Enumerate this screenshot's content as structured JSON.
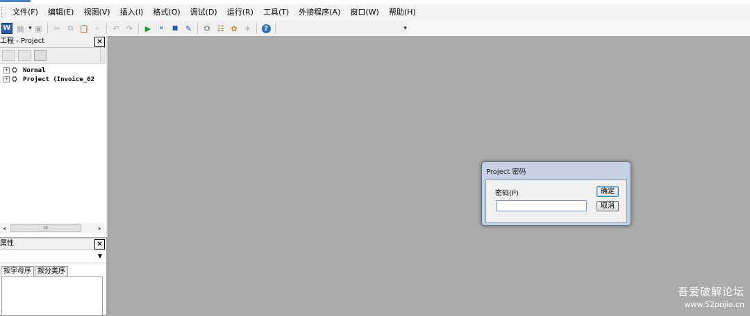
{
  "menubar": {
    "items": [
      "文件(F)",
      "编辑(E)",
      "视图(V)",
      "插入(I)",
      "格式(O)",
      "调试(D)",
      "运行(R)",
      "工具(T)",
      "外接程序(A)",
      "窗口(W)",
      "帮助(H)"
    ]
  },
  "toolbar": {
    "buttons": [
      {
        "icon": "word-icon",
        "glyph": "W"
      },
      {
        "icon": "insert-userform-icon",
        "glyph": "▦"
      },
      {
        "icon": "save-icon",
        "glyph": "▣"
      },
      {
        "icon": "cut-icon",
        "glyph": "✂"
      },
      {
        "icon": "copy-icon",
        "glyph": "⧉"
      },
      {
        "icon": "paste-icon",
        "glyph": "📋"
      },
      {
        "icon": "find-icon",
        "glyph": "⌕"
      },
      {
        "icon": "undo-icon",
        "glyph": "↶"
      },
      {
        "icon": "redo-icon",
        "glyph": "↷"
      },
      {
        "icon": "run-icon",
        "glyph": "▶"
      },
      {
        "icon": "break-icon",
        "glyph": "⏸"
      },
      {
        "icon": "reset-icon",
        "glyph": "■"
      },
      {
        "icon": "design-mode-icon",
        "glyph": "✎"
      },
      {
        "icon": "project-explorer-icon",
        "glyph": "⛭"
      },
      {
        "icon": "properties-window-icon",
        "glyph": "☷"
      },
      {
        "icon": "object-browser-icon",
        "glyph": "✿"
      },
      {
        "icon": "toolbox-icon",
        "glyph": "✈"
      },
      {
        "icon": "help-icon",
        "glyph": "?"
      }
    ]
  },
  "project_panel": {
    "title": "工程 - Project",
    "close": "×",
    "tree": [
      {
        "expander": "+",
        "label": "Normal"
      },
      {
        "expander": "+",
        "label": "Project (Invoice_62"
      }
    ],
    "hscroll_thumb": "III"
  },
  "properties_panel": {
    "title": "属性",
    "close": "×",
    "tabs": [
      "按字母序",
      "按分类序"
    ]
  },
  "dialog": {
    "title": "Project 密码",
    "label": "密码(P)",
    "password_value": "",
    "ok_label": "确定",
    "cancel_label": "取消"
  },
  "watermark": {
    "title": "吾爱破解论坛",
    "url": "www.52pojie.cn"
  }
}
